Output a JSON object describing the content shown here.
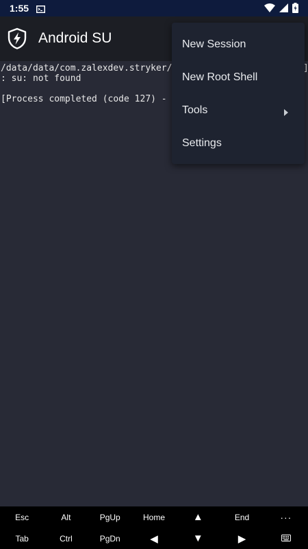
{
  "status_bar": {
    "time": "1:55",
    "icons": [
      "terminal-notification-icon",
      "wifi-icon",
      "cell-signal-icon",
      "battery-icon"
    ]
  },
  "app_bar": {
    "title": "Android SU",
    "icon": "shield-lightning-icon"
  },
  "terminal": {
    "lines": [
      "/data/data/com.zalexdev.stryker/fi",
      ": su: not found",
      "",
      "[Process completed (code 127) - pr"
    ],
    "bracket": "]"
  },
  "menu": {
    "items": [
      {
        "label": "New Session"
      },
      {
        "label": "New Root Shell"
      },
      {
        "label": "Tools",
        "has_submenu": true
      },
      {
        "label": "Settings"
      }
    ]
  },
  "extra_keys": {
    "row1": [
      "Esc",
      "Alt",
      "PgUp",
      "Home",
      "▲",
      "End",
      "···"
    ],
    "row2": [
      "Tab",
      "Ctrl",
      "PgDn",
      "◀",
      "▼",
      "▶",
      "keyboard-icon"
    ]
  },
  "colors": {
    "status_bar": "#0e1b3d",
    "app_bar": "#1c1e24",
    "terminal_bg": "#282a36",
    "menu_bg": "#1e2330",
    "extra_keys_bg": "#000000"
  }
}
